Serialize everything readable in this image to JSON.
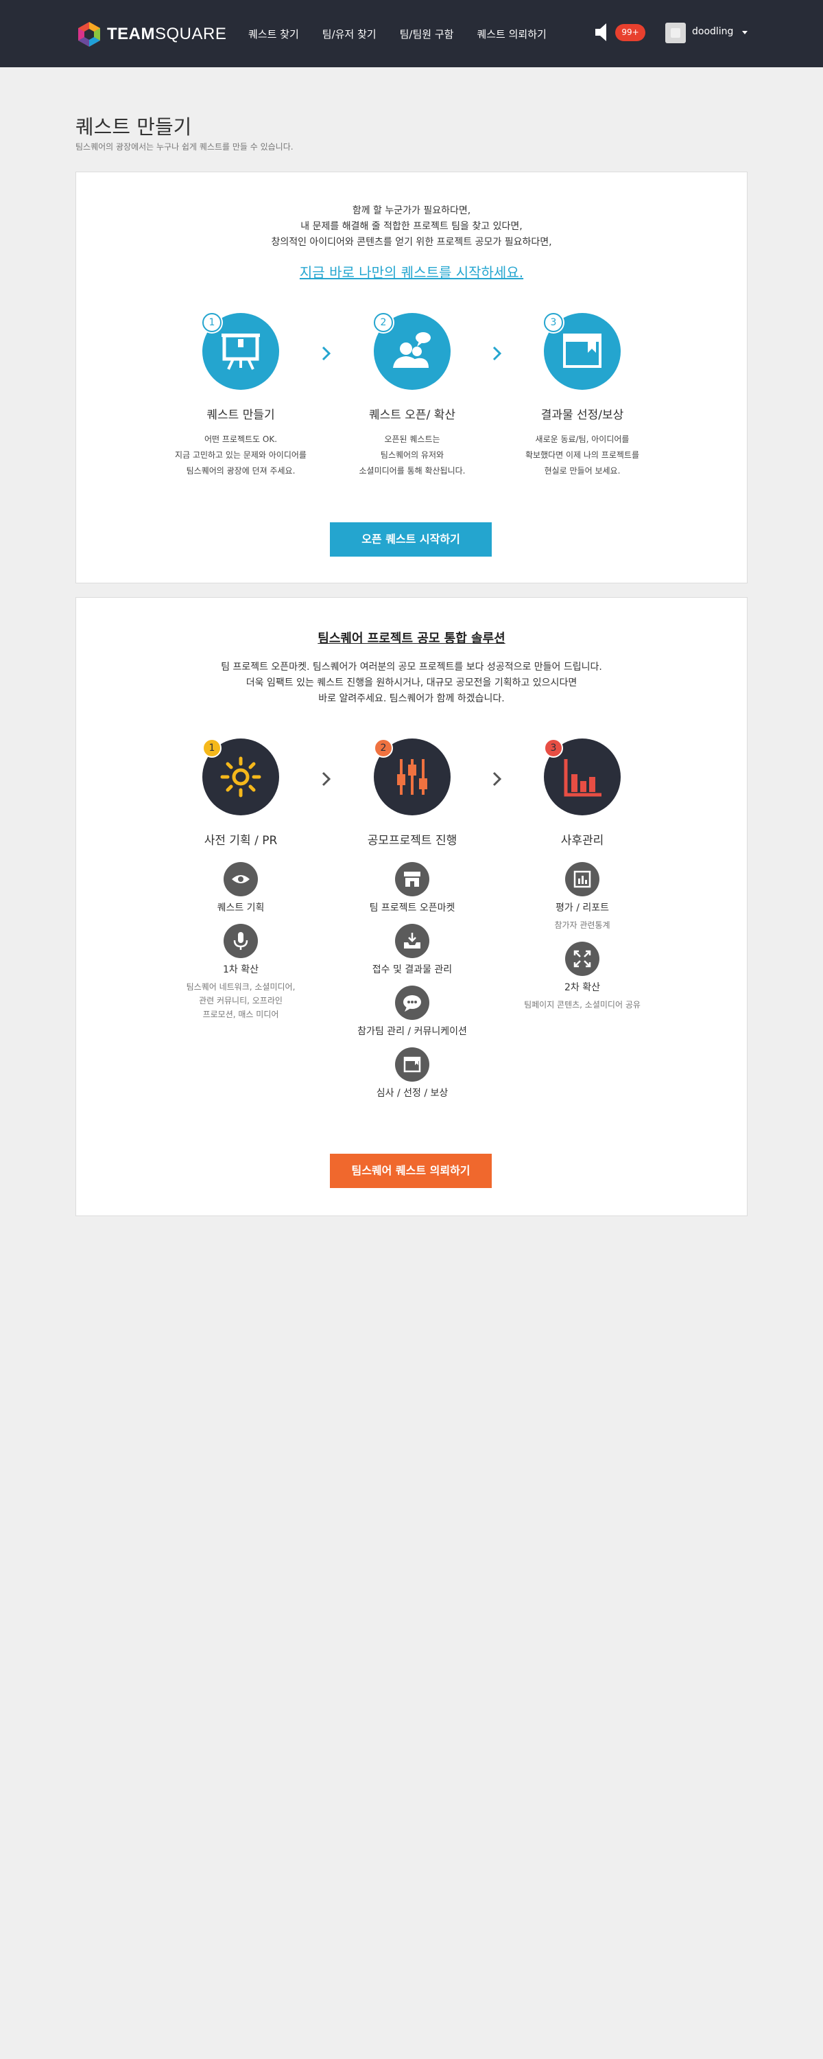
{
  "header": {
    "brand": {
      "bold": "TEAM",
      "light": "SQUARE"
    },
    "nav": [
      "퀘스트 찾기",
      "팀/유저 찾기",
      "팀/팀원 구함",
      "퀘스트 의뢰하기"
    ],
    "notification_count": "99+",
    "username": "doodling"
  },
  "page": {
    "title": "퀘스트 만들기",
    "subtitle": "팀스퀘어의 광장에서는 누구나 쉽게 퀘스트를 만들 수 있습니다."
  },
  "intro": {
    "lines": [
      "함께 할 누군가가 필요하다면,",
      "내 문제를 해결해 줄 적합한 프로젝트 팀을 찾고 있다면,",
      "창의적인 아이디어와 콘텐츠를 얻기 위한 프로젝트 공모가 필요하다면,"
    ],
    "cta_link": "지금 바로 나만의 퀘스트를 시작하세요.",
    "steps": [
      {
        "num": "1",
        "icon": "presentation-board-icon",
        "title": "퀘스트 만들기",
        "desc": [
          "어떤 프로젝트도 OK.",
          "지금 고민하고 있는 문제와 아이디어를",
          "팀스퀘어의 광장에 던져 주세요."
        ]
      },
      {
        "num": "2",
        "icon": "users-chat-icon",
        "title": "퀘스트 오픈/ 확산",
        "desc": [
          "오픈된 퀘스트는",
          "팀스퀘어의 유저와",
          "소셜미디어를 통해 확산됩니다."
        ]
      },
      {
        "num": "3",
        "icon": "browser-bookmark-icon",
        "title": "결과물 선정/보상",
        "desc": [
          "새로운 동료/팀, 아이디어를",
          "확보했다면 이제 나의 프로젝트를",
          "현실로 만들어 보세요."
        ]
      }
    ],
    "button": "오픈 퀘스트 시작하기"
  },
  "solution": {
    "heading": "팀스퀘어 프로젝트 공모 통합 솔루션",
    "lines": [
      "팀 프로젝트 오픈마켓. 팀스퀘어가 여러분의 공모 프로젝트를 보다 성공적으로 만들어 드립니다.",
      "더욱 임팩트 있는 퀘스트 진행을 원하시거나, 대규모 공모전을 기획하고 있으시다면",
      "바로 알려주세요. 팀스퀘어가 함께 하겠습니다."
    ],
    "steps": [
      {
        "num": "1",
        "icon": "sun-icon",
        "title": "사전 기획 / PR"
      },
      {
        "num": "2",
        "icon": "sliders-icon",
        "title": "공모프로젝트 진행"
      },
      {
        "num": "3",
        "icon": "bar-chart-icon",
        "title": "사후관리"
      }
    ],
    "columns": [
      [
        {
          "icon": "eye-icon",
          "label": "퀘스트 기획",
          "sub": []
        },
        {
          "icon": "microphone-icon",
          "label": "1차 확산",
          "sub": [
            "팀스퀘어 네트워크, 소셜미디어,",
            "관련 커뮤니티, 오프라인",
            "프로모션, 매스 미디어"
          ]
        }
      ],
      [
        {
          "icon": "store-icon",
          "label": "팀 프로젝트 오픈마켓",
          "sub": []
        },
        {
          "icon": "inbox-icon",
          "label": "접수 및 결과물 관리",
          "sub": []
        },
        {
          "icon": "chat-bubble-icon",
          "label": "참가팀 관리 / 커뮤니케이션",
          "sub": []
        },
        {
          "icon": "window-icon",
          "label": "심사 / 선정 /  보상",
          "sub": []
        }
      ],
      [
        {
          "icon": "report-icon",
          "label": "평가 / 리포트",
          "sub": [
            "참가자 관련통계"
          ]
        },
        {
          "icon": "expand-icon",
          "label": "2차 확산",
          "sub": [
            "팀페이지 콘텐츠, 소셜미디어 공유"
          ]
        }
      ]
    ],
    "button": "팀스퀘어 퀘스트 의뢰하기"
  }
}
